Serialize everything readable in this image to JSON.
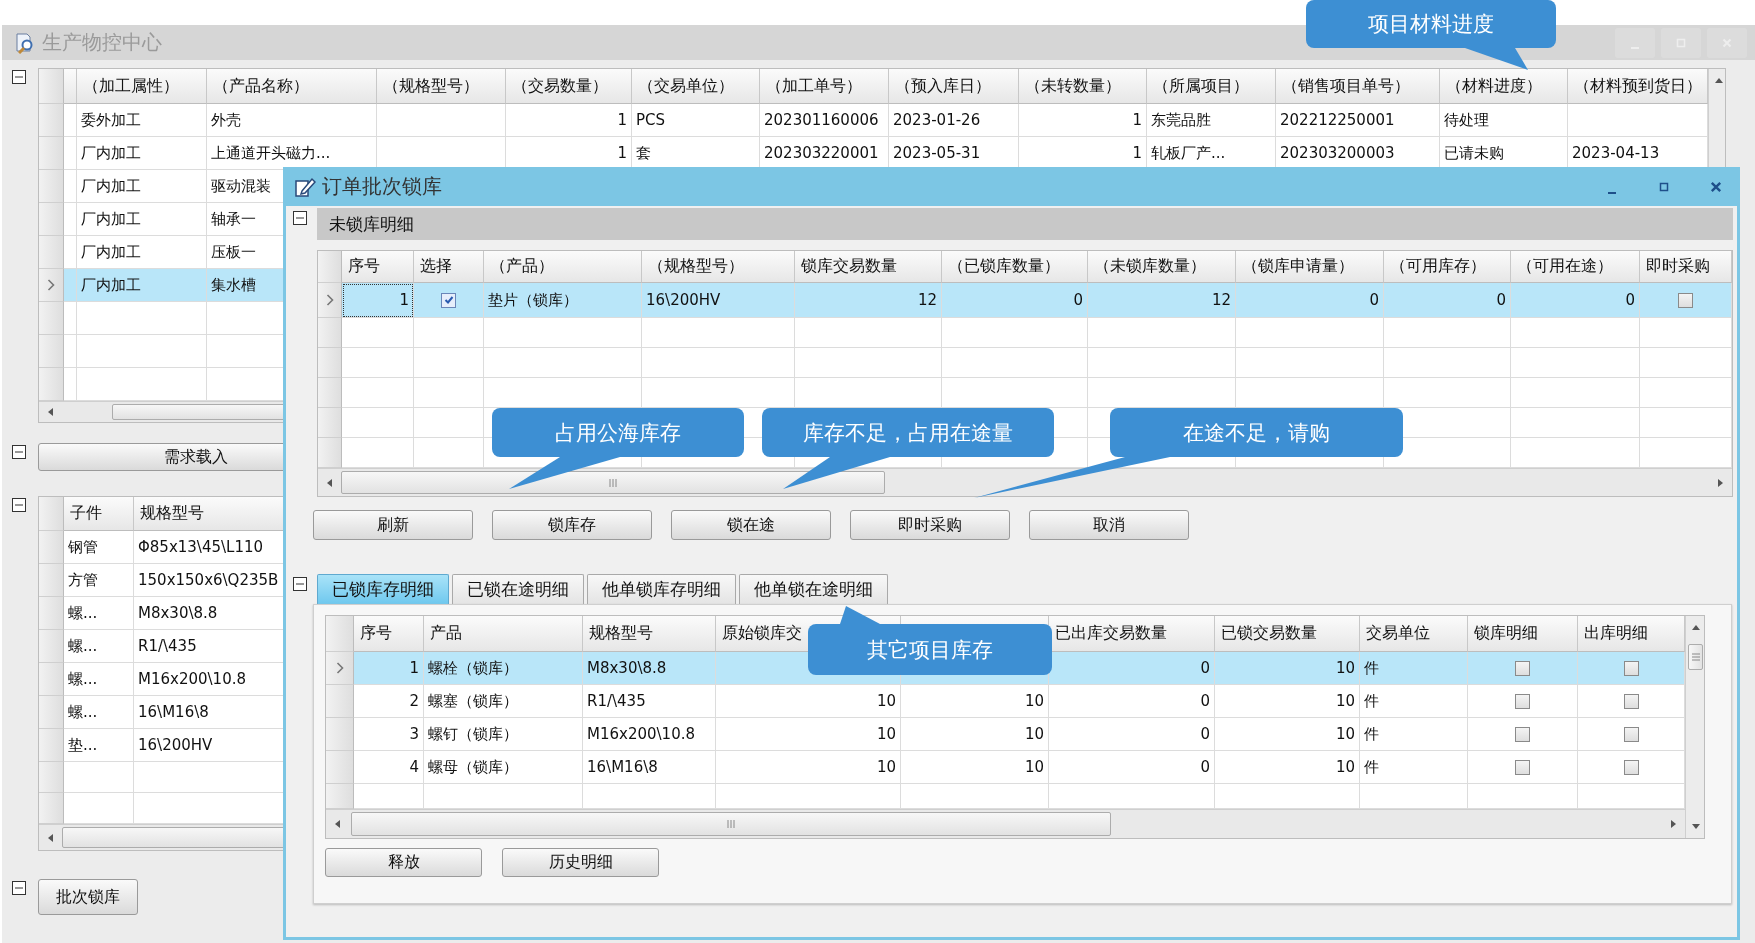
{
  "main_window": {
    "title": "生产物控中心"
  },
  "orders_table": {
    "columns": [
      {
        "label": "（加工属性）",
        "kind": "text"
      },
      {
        "label": "（产品名称）",
        "kind": "text"
      },
      {
        "label": "（规格型号）",
        "kind": "text"
      },
      {
        "label": "（交易数量）",
        "kind": "number"
      },
      {
        "label": "（交易单位）",
        "kind": "text"
      },
      {
        "label": "（加工单号）",
        "kind": "text"
      },
      {
        "label": "（预入库日）",
        "kind": "text"
      },
      {
        "label": "（未转数量）",
        "kind": "number"
      },
      {
        "label": "（所属项目）",
        "kind": "text"
      },
      {
        "label": "（销售项目单号）",
        "kind": "text"
      },
      {
        "label": "（材料进度）",
        "kind": "text"
      },
      {
        "label": "（材料预到货日）",
        "kind": "text"
      }
    ],
    "rows": [
      {
        "selected": false,
        "cells": [
          "委外加工",
          "外壳",
          null,
          "1",
          "PCS",
          "202301160006",
          "2023-01-26",
          "1",
          "东莞品胜",
          "202212250001",
          "待处理",
          null
        ]
      },
      {
        "selected": false,
        "cells": [
          "厂内加工",
          "上通道开头磁力...",
          null,
          "1",
          "套",
          "202303220001",
          "2023-05-31",
          "1",
          "轧板厂产...",
          "202303200003",
          "已请未购",
          "2023-04-13"
        ]
      },
      {
        "selected": false,
        "cells": [
          "厂内加工",
          "驱动混装"
        ]
      },
      {
        "selected": false,
        "cells": [
          "厂内加工",
          "轴承一"
        ]
      },
      {
        "selected": false,
        "cells": [
          "厂内加工",
          "压板一"
        ]
      },
      {
        "selected": true,
        "cells": [
          "厂内加工",
          "集水槽"
        ]
      }
    ]
  },
  "demand_load_button": "需求载入",
  "parts_table": {
    "columns": [
      {
        "label": "子件"
      },
      {
        "label": "规格型号"
      }
    ],
    "rows": [
      {
        "selected": false,
        "cells": [
          "钢管",
          "Φ85x13\\45\\L110"
        ]
      },
      {
        "selected": false,
        "cells": [
          "方管",
          "150x150x6\\Q235B"
        ]
      },
      {
        "selected": false,
        "cells": [
          "螺...",
          "M8x30\\8.8"
        ]
      },
      {
        "selected": false,
        "cells": [
          "螺...",
          "R1/\\435"
        ]
      },
      {
        "selected": false,
        "cells": [
          "螺...",
          "M16x200\\10.8"
        ]
      },
      {
        "selected": false,
        "cells": [
          "螺...",
          "16\\M16\\8"
        ]
      },
      {
        "selected": false,
        "cells": [
          "垫...",
          "16\\200HV"
        ]
      }
    ]
  },
  "batch_lock_button": "批次锁库",
  "dialog": {
    "title": "订单批次锁库",
    "unlocked_section": {
      "title": "未锁库明细",
      "table": {
        "columns": [
          {
            "label": "序号",
            "kind": "number"
          },
          {
            "label": "选择",
            "kind": "check"
          },
          {
            "label": "（产品）",
            "kind": "text"
          },
          {
            "label": "（规格型号）",
            "kind": "text"
          },
          {
            "label": "锁库交易数量",
            "kind": "number"
          },
          {
            "label": "（已锁库数量）",
            "kind": "number"
          },
          {
            "label": "（未锁库数量）",
            "kind": "number"
          },
          {
            "label": "（锁库申请量）",
            "kind": "number"
          },
          {
            "label": "（可用库存）",
            "kind": "number"
          },
          {
            "label": "（可用在途）",
            "kind": "number"
          },
          {
            "label": "即时采购",
            "kind": "check"
          }
        ],
        "rows": [
          {
            "selected": true,
            "cells": [
              "1",
              true,
              "垫片（锁库）",
              "16\\200HV",
              "12",
              "0",
              "12",
              "0",
              "0",
              "0",
              false
            ]
          }
        ]
      }
    },
    "buttons": [
      "刷新",
      "锁库存",
      "锁在途",
      "即时采购",
      "取消"
    ],
    "tabs": [
      {
        "label": "已锁库存明细",
        "selected": true
      },
      {
        "label": "已锁在途明细",
        "selected": false
      },
      {
        "label": "他单锁库存明细",
        "selected": false
      },
      {
        "label": "他单锁在途明细",
        "selected": false
      }
    ],
    "locked_table": {
      "columns": [
        {
          "label": "序号",
          "kind": "number"
        },
        {
          "label": "产品",
          "kind": "text"
        },
        {
          "label": "规格型号",
          "kind": "text"
        },
        {
          "label": "原始锁库交",
          "kind": "number"
        },
        {
          "kind": "number"
        },
        {
          "label": "已出库交易数量",
          "kind": "number"
        },
        {
          "label": "已锁交易数量",
          "kind": "number"
        },
        {
          "label": "交易单位",
          "kind": "text"
        },
        {
          "label": "锁库明细",
          "kind": "check"
        },
        {
          "label": "出库明细",
          "kind": "check"
        }
      ],
      "rows": [
        {
          "selected": true,
          "cells": [
            "1",
            "螺栓（锁库）",
            "M8x30\\8.8",
            null,
            null,
            "0",
            "10",
            "件",
            false,
            false
          ]
        },
        {
          "selected": false,
          "cells": [
            "2",
            "螺塞（锁库）",
            "R1/\\435",
            "10",
            "10",
            "0",
            "10",
            "件",
            false,
            false
          ]
        },
        {
          "selected": false,
          "cells": [
            "3",
            "螺钉（锁库）",
            "M16x200\\10.8",
            "10",
            "10",
            "0",
            "10",
            "件",
            false,
            false
          ]
        },
        {
          "selected": false,
          "cells": [
            "4",
            "螺母（锁库）",
            "16\\M16\\8",
            "10",
            "10",
            "0",
            "10",
            "件",
            false,
            false
          ]
        }
      ]
    },
    "locked_buttons": [
      "释放",
      "历史明细"
    ]
  },
  "callouts": [
    "项目材料进度",
    "占用公海库存",
    "库存不足，占用在途量",
    "在途不足，请购",
    "其它项目库存"
  ]
}
